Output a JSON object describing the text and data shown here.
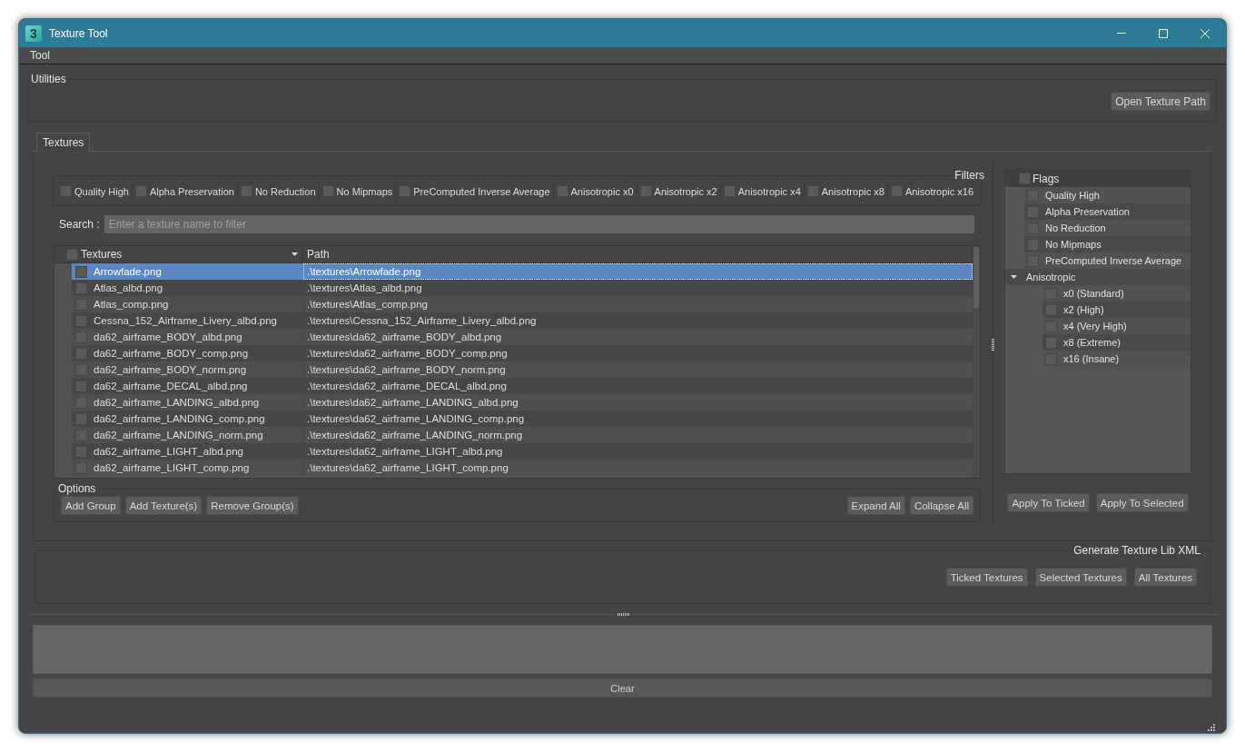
{
  "window": {
    "logo": "3",
    "title": "Texture Tool"
  },
  "menu_bar": [
    {
      "label": "Tool"
    }
  ],
  "utilities": {
    "title": "Utilities",
    "buttons": [
      "Open Texture Path"
    ]
  },
  "tabs": [
    {
      "label": "Textures",
      "selected": true
    }
  ],
  "filters": {
    "title": "Filters",
    "items": [
      {
        "label": "Quality High",
        "checked": false
      },
      {
        "label": "Alpha Preservation",
        "checked": false
      },
      {
        "label": "No Reduction",
        "checked": false
      },
      {
        "label": "No Mipmaps",
        "checked": false
      },
      {
        "label": "PreComputed Inverse Average",
        "checked": false
      },
      {
        "label": "Anisotropic x0",
        "checked": false
      },
      {
        "label": "Anisotropic x2",
        "checked": false
      },
      {
        "label": "Anisotropic x4",
        "checked": false
      },
      {
        "label": "Anisotropic x8",
        "checked": false
      },
      {
        "label": "Anisotropic x16",
        "checked": false
      }
    ]
  },
  "search": {
    "label": "Search :",
    "placeholder": "Enter a texture name to filter"
  },
  "texture_table": {
    "columns": [
      {
        "label": "Textures",
        "checked": false,
        "sorted": true
      },
      {
        "label": "Path"
      }
    ],
    "rows": [
      {
        "name": "Arrowfade.png",
        "path": ".\\textures\\Arrowfade.png",
        "checked": false,
        "selected": true
      },
      {
        "name": "Atlas_albd.png",
        "path": ".\\textures\\Atlas_albd.png",
        "checked": false,
        "selected": false
      },
      {
        "name": "Atlas_comp.png",
        "path": ".\\textures\\Atlas_comp.png",
        "checked": false,
        "selected": false
      },
      {
        "name": "Cessna_152_Airframe_Livery_albd.png",
        "path": ".\\textures\\Cessna_152_Airframe_Livery_albd.png",
        "checked": false,
        "selected": false
      },
      {
        "name": "da62_airframe_BODY_albd.png",
        "path": ".\\textures\\da62_airframe_BODY_albd.png",
        "checked": false,
        "selected": false
      },
      {
        "name": "da62_airframe_BODY_comp.png",
        "path": ".\\textures\\da62_airframe_BODY_comp.png",
        "checked": false,
        "selected": false
      },
      {
        "name": "da62_airframe_BODY_norm.png",
        "path": ".\\textures\\da62_airframe_BODY_norm.png",
        "checked": false,
        "selected": false
      },
      {
        "name": "da62_airframe_DECAL_albd.png",
        "path": ".\\textures\\da62_airframe_DECAL_albd.png",
        "checked": false,
        "selected": false
      },
      {
        "name": "da62_airframe_LANDING_albd.png",
        "path": ".\\textures\\da62_airframe_LANDING_albd.png",
        "checked": false,
        "selected": false
      },
      {
        "name": "da62_airframe_LANDING_comp.png",
        "path": ".\\textures\\da62_airframe_LANDING_comp.png",
        "checked": false,
        "selected": false
      },
      {
        "name": "da62_airframe_LANDING_norm.png",
        "path": ".\\textures\\da62_airframe_LANDING_norm.png",
        "checked": false,
        "selected": false
      },
      {
        "name": "da62_airframe_LIGHT_albd.png",
        "path": ".\\textures\\da62_airframe_LIGHT_albd.png",
        "checked": false,
        "selected": false
      },
      {
        "name": "da62_airframe_LIGHT_comp.png",
        "path": ".\\textures\\da62_airframe_LIGHT_comp.png",
        "checked": false,
        "selected": false
      }
    ]
  },
  "options": {
    "title": "Options",
    "left_buttons": [
      "Add Group",
      "Add Texture(s)",
      "Remove Group(s)"
    ],
    "right_buttons": [
      "Expand All",
      "Collapse All"
    ]
  },
  "flags_tree": {
    "header": {
      "label": "Flags",
      "checked": false
    },
    "items": [
      {
        "kind": "check",
        "label": "Quality High",
        "checked": false
      },
      {
        "kind": "check",
        "label": "Alpha Preservation",
        "checked": false
      },
      {
        "kind": "check",
        "label": "No Reduction",
        "checked": false
      },
      {
        "kind": "check",
        "label": "No Mipmaps",
        "checked": false
      },
      {
        "kind": "check",
        "label": "PreComputed Inverse Average",
        "checked": false
      },
      {
        "kind": "group",
        "label": "Anisotropic",
        "expanded": true,
        "children": [
          {
            "kind": "check",
            "label": "x0 (Standard)",
            "checked": false
          },
          {
            "kind": "check",
            "label": "x2 (High)",
            "checked": false
          },
          {
            "kind": "check",
            "label": "x4 (Very High)",
            "checked": false
          },
          {
            "kind": "check",
            "label": "x8 (Extreme)",
            "checked": false
          },
          {
            "kind": "check",
            "label": "x16 (Insane)",
            "checked": false
          }
        ]
      }
    ],
    "buttons": [
      "Apply To Ticked",
      "Apply To Selected"
    ]
  },
  "generate_xml": {
    "title": "Generate Texture Lib XML",
    "buttons": [
      "Ticked Textures",
      "Selected Textures",
      "All Textures"
    ]
  },
  "output": {
    "clear_button": "Clear"
  }
}
